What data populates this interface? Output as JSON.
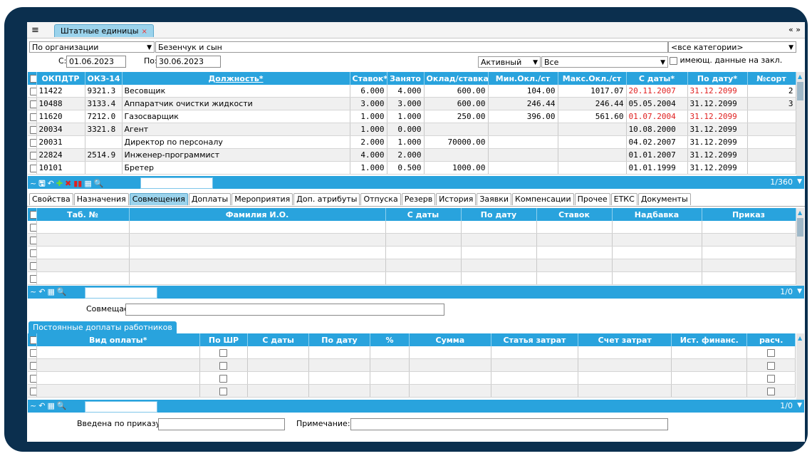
{
  "window": {
    "tab_title": "Штатные единицы",
    "tab_close": "×",
    "menu_icon": "≡",
    "nav": "« »"
  },
  "filters": {
    "org_select": "По организации",
    "org_name": "Безенчук и сын",
    "category": "<все категории>",
    "from_label": "С:",
    "from_value": "01.06.2023",
    "to_label": "По:",
    "to_value": "30.06.2023",
    "status": "Активный",
    "status2": "Все",
    "has_data_label": "имеющ. данные на закл."
  },
  "main_grid": {
    "columns": [
      "ОКПДТР",
      "ОКЗ-14",
      "Должность*",
      "Ставок*",
      "Занято",
      "Оклад/ставка",
      "Мин.Окл./ст",
      "Макс.Окл./ст",
      "С даты*",
      "По дату*",
      "№сорт"
    ],
    "rows": [
      [
        "11422",
        "9321.3",
        "Весовщик",
        "6.000",
        "4.000",
        "600.00",
        "104.00",
        "1017.07",
        "20.11.2007",
        "31.12.2099",
        "2"
      ],
      [
        "10488",
        "3133.4",
        "Аппаратчик очистки жидкости",
        "3.000",
        "3.000",
        "600.00",
        "246.44",
        "246.44",
        "05.05.2004",
        "31.12.2099",
        "3"
      ],
      [
        "11620",
        "7212.0",
        "Газосварщик",
        "1.000",
        "1.000",
        "250.00",
        "396.00",
        "561.60",
        "01.07.2004",
        "31.12.2099",
        ""
      ],
      [
        "20034",
        "3321.8",
        "Агент",
        "1.000",
        "0.000",
        "",
        "",
        "",
        "10.08.2000",
        "31.12.2099",
        ""
      ],
      [
        "20031",
        "",
        "Директор по персоналу",
        "2.000",
        "1.000",
        "70000.00",
        "",
        "",
        "04.02.2007",
        "31.12.2099",
        ""
      ],
      [
        "22824",
        "2514.9",
        "Инженер-программист",
        "4.000",
        "2.000",
        "",
        "",
        "",
        "01.01.2007",
        "31.12.2099",
        ""
      ],
      [
        "10101",
        "",
        "Бретер",
        "1.000",
        "0.500",
        "1000.00",
        "",
        "",
        "01.01.1999",
        "31.12.2099",
        ""
      ]
    ],
    "counter": "1/360"
  },
  "tabs": [
    "Свойства",
    "Назначения",
    "Совмещения",
    "Доплаты",
    "Мероприятия",
    "Доп. атрибуты",
    "Отпуска",
    "Резерв",
    "История",
    "Заявки",
    "Компенсации",
    "Прочее",
    "ЕТКС",
    "Документы"
  ],
  "combo_grid": {
    "columns": [
      "Таб. №",
      "Фамилия И.О.",
      "С даты",
      "По дату",
      "Ставок",
      "Надбавка",
      "Приказ"
    ],
    "counter": "1/0",
    "combines_label": "Совмещает:"
  },
  "pay_section": {
    "tab": "Постоянные доплаты работников",
    "columns": [
      "Вид оплаты*",
      "По ШР",
      "С даты",
      "По дату",
      "%",
      "Сумма",
      "Статья затрат",
      "Счет затрат",
      "Ист. финанс.",
      "расч."
    ],
    "counter": "1/0",
    "order_label": "Введена по приказу:",
    "note_label": "Примечание:"
  },
  "colors": {
    "accent": "#29a3dd",
    "frame": "#0b2f4e",
    "red_date": "#e02020"
  }
}
